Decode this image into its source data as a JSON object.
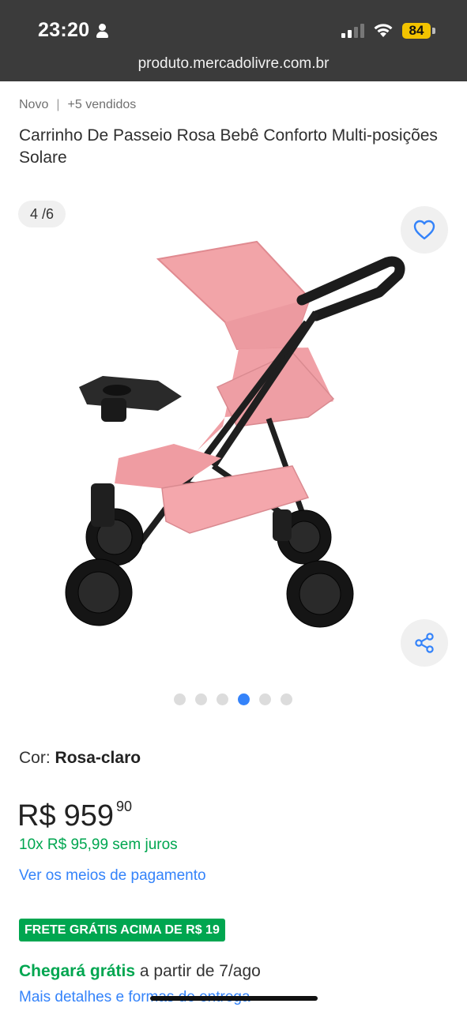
{
  "status_bar": {
    "time": "23:20",
    "battery": "84",
    "url": "produto.mercadolivre.com.br"
  },
  "product": {
    "condition": "Novo",
    "sold": "+5 vendidos",
    "title": "Carrinho De Passeio Rosa Bebê Conforto Multi-posições Solare"
  },
  "gallery": {
    "counter": "4 /6",
    "total_images": 6,
    "active_index": 4,
    "image_icon": "pink-baby-stroller-photo"
  },
  "variant": {
    "label": "Cor:",
    "value": "Rosa-claro"
  },
  "price": {
    "currency": "R$",
    "integer": "959",
    "cents": "90",
    "installments": "10x R$ 95,99 sem juros",
    "payment_link": "Ver os meios de pagamento"
  },
  "shipping": {
    "badge": "FRETE GRÁTIS ACIMA DE R$ 19",
    "arrival_strong": "Chegará grátis",
    "arrival_rest": "a partir de 7/ago",
    "details_link": "Mais detalhes e formas de entrega"
  },
  "colors": {
    "accent_blue": "#3483fa",
    "green": "#00a650",
    "status_bg": "#3b3b3b",
    "battery": "#f2c300"
  }
}
